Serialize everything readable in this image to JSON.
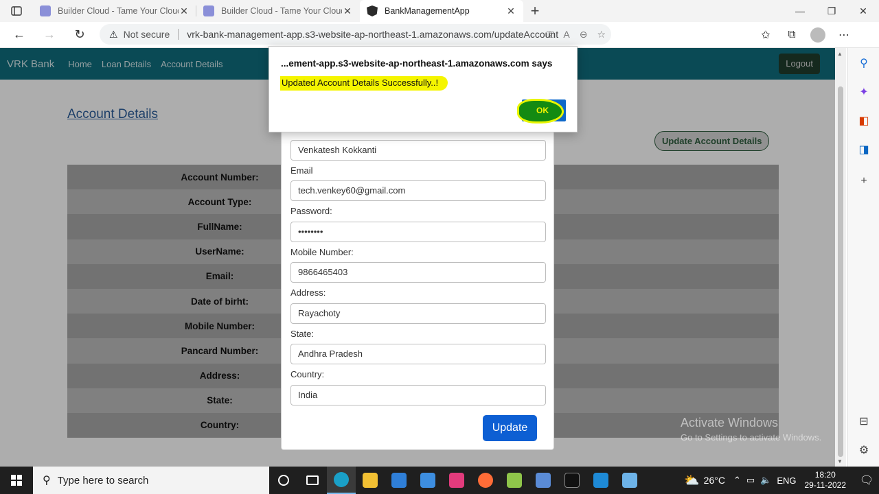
{
  "browser": {
    "tabs": [
      {
        "title": "Builder Cloud - Tame Your Cloud",
        "active": false
      },
      {
        "title": "Builder Cloud - Tame Your Cloud",
        "active": false
      },
      {
        "title": "BankManagementApp",
        "active": true
      }
    ],
    "security_label": "Not secure",
    "url": "vrk-bank-management-app.s3-website-ap-northeast-1.amazonaws.com/updateAccount"
  },
  "nav": {
    "brand": "VRK Bank",
    "links": [
      "Home",
      "Loan Details",
      "Account Details"
    ],
    "logout": "Logout"
  },
  "page": {
    "title": "Account Details",
    "update_account_button": "Update Account Details",
    "detail_labels": [
      "Account Number:",
      "Account Type:",
      "FullName:",
      "UserName:",
      "Email:",
      "Date of birht:",
      "Mobile Number:",
      "Pancard Number:",
      "Address:",
      "State:",
      "Country:"
    ]
  },
  "form": {
    "fullname_value": "Venkatesh Kokkanti",
    "email_label": "Email",
    "email_value": "tech.venkey60@gmail.com",
    "password_label": "Password:",
    "password_value": "••••••••",
    "mobile_label": "Mobile Number:",
    "mobile_value": "9866465403",
    "address_label": "Address:",
    "address_value": "Rayachoty",
    "state_label": "State:",
    "state_value": "Andhra Pradesh",
    "country_label": "Country:",
    "country_value": "India",
    "submit": "Update"
  },
  "alert": {
    "title": "...ement-app.s3-website-ap-northeast-1.amazonaws.com says",
    "message": "Updated Account Details Successfully..!",
    "ok": "OK"
  },
  "watermark": {
    "line1": "Activate Windows",
    "line2": "Go to Settings to activate Windows."
  },
  "taskbar": {
    "search_placeholder": "Type here to search",
    "temperature": "26°C",
    "language": "ENG",
    "time": "18:20",
    "date": "29-11-2022"
  }
}
